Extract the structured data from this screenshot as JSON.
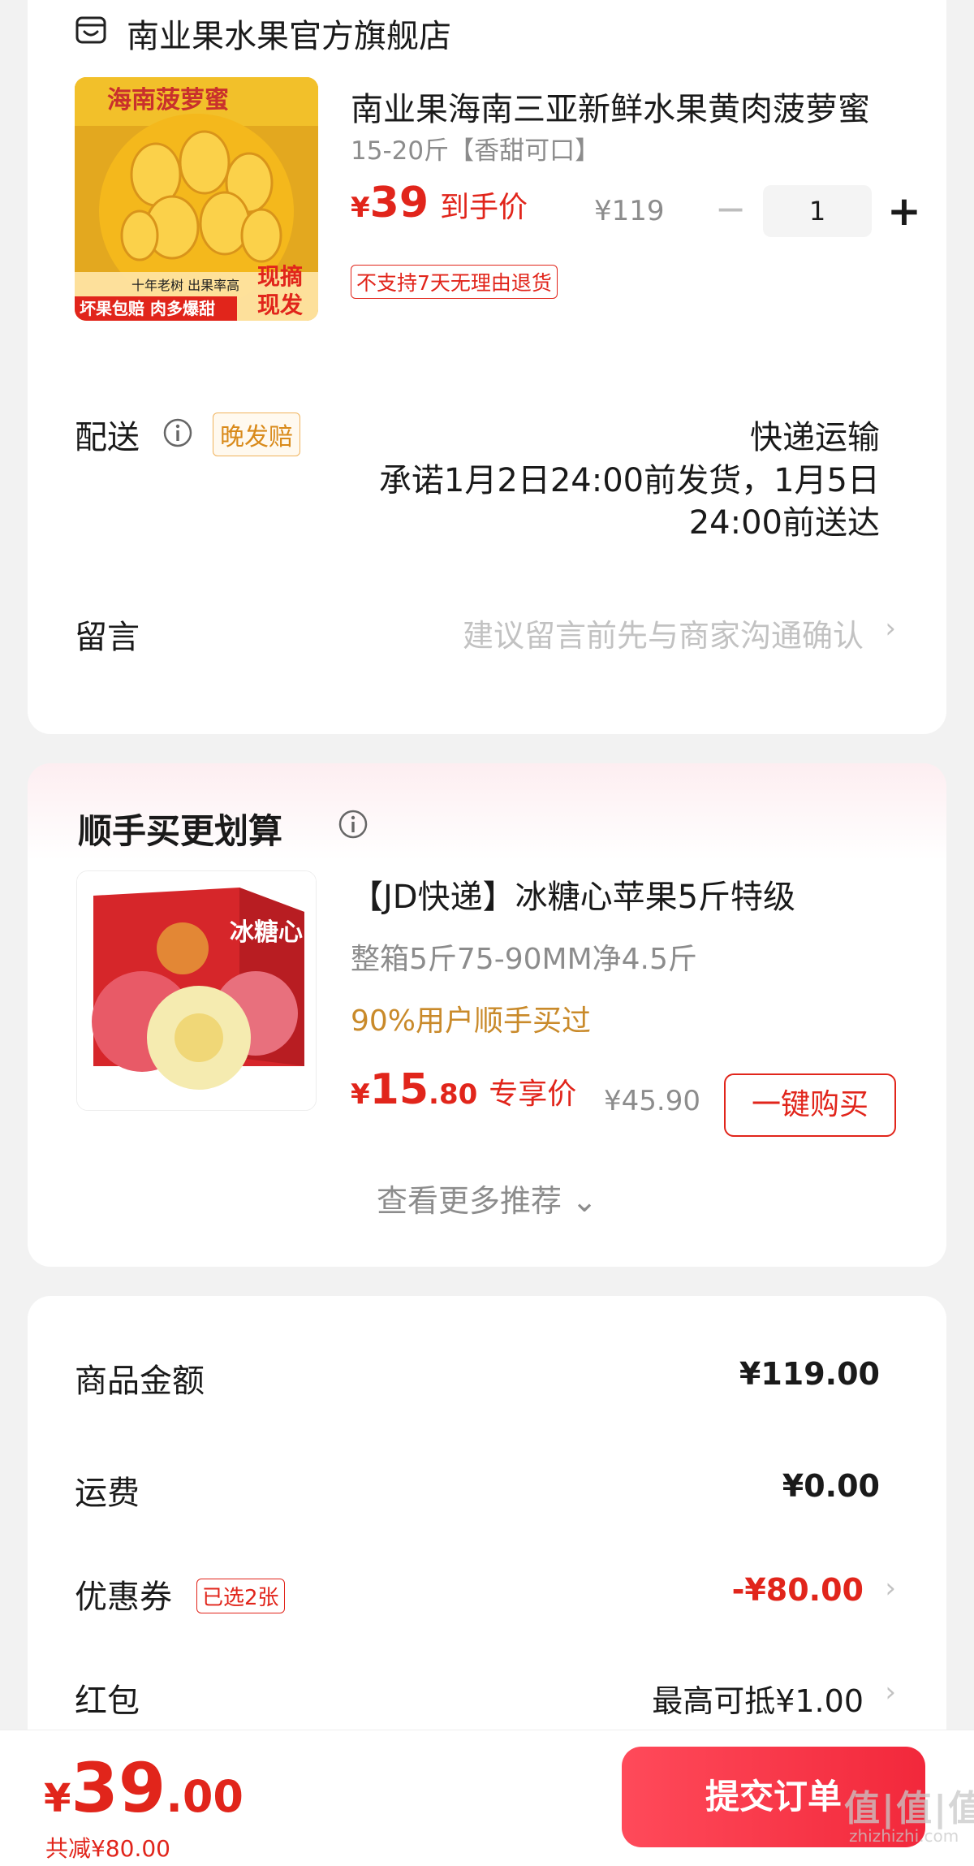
{
  "store": {
    "name": "南业果水果官方旗舰店",
    "icon": "store-icon"
  },
  "product": {
    "title": "南业果海南三亚新鲜水果黄肉菠萝蜜",
    "spec": "15-20斤【香甜可口】",
    "price_symbol": "¥",
    "price": "39",
    "price_label": "到手价",
    "original_price": "¥119",
    "quantity": "1",
    "minus": "−",
    "plus": "+",
    "return_policy": "不支持7天无理由退货",
    "image_text": {
      "top": "海南菠萝蜜",
      "mid": "十年老树 出果率高",
      "bottom": "坏果包赔 肉多爆甜",
      "side1": "现摘",
      "side2": "现发"
    }
  },
  "delivery": {
    "label": "配送",
    "tag": "晚发赔",
    "method": "快递运输",
    "promise": "承诺1月2日24:00前发货，1月5日24:00前送达"
  },
  "message": {
    "label": "留言",
    "placeholder": "建议留言前先与商家沟通确认"
  },
  "recommend": {
    "title": "顺手买更划算",
    "item": {
      "name": "【JD快递】冰糖心苹果5斤特级",
      "spec": "整箱5斤75-90MM净4.5斤",
      "popularity": "90%用户顺手买过",
      "price_symbol": "¥",
      "price_int": "15",
      "price_dec": ".80",
      "price_label": "专享价",
      "original_price": "¥45.90",
      "buy_label": "一键购买",
      "image_text": "冰糖心"
    },
    "more_label": "查看更多推荐"
  },
  "summary": {
    "goods_label": "商品金额",
    "goods_value": "¥119.00",
    "shipping_label": "运费",
    "shipping_value": "¥0.00",
    "coupon_label": "优惠券",
    "coupon_tag": "已选2张",
    "coupon_value": "-¥80.00",
    "redpack_label": "红包",
    "redpack_value": "最高可抵¥1.00"
  },
  "bottom": {
    "price_symbol": "¥",
    "price_int": "39",
    "price_dec": ".00",
    "save_text": "共减¥80.00",
    "submit_label": "提交订单",
    "watermark": "值|值|值",
    "watermark_sub": "zhizhizhi.com"
  },
  "colors": {
    "accent": "#e1251b",
    "background": "#f2f2f2",
    "tag_orange": "#d98a1a"
  }
}
